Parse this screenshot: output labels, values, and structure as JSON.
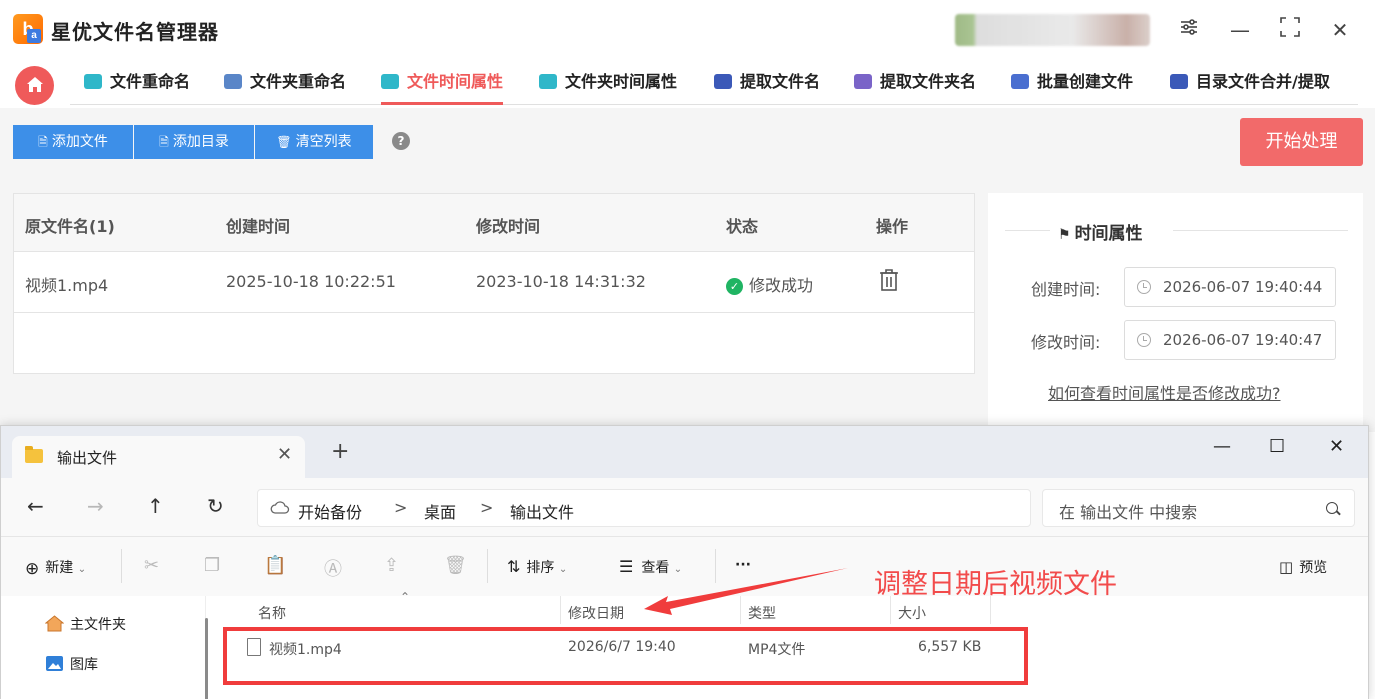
{
  "app": {
    "title": "星优文件名管理器",
    "logo_text": "b",
    "logo_sub": "a"
  },
  "window_controls": {
    "settings": "⚙",
    "minimize": "—",
    "maximize": "▢",
    "close": "✕"
  },
  "tabs": [
    {
      "label": "文件重命名",
      "color": "#2fb7c9"
    },
    {
      "label": "文件夹重命名",
      "color": "#5a86c8"
    },
    {
      "label": "文件时间属性",
      "color": "#2fb7c9",
      "active": true
    },
    {
      "label": "文件夹时间属性",
      "color": "#2fb7c9"
    },
    {
      "label": "提取文件名",
      "color": "#3b59b8"
    },
    {
      "label": "提取文件夹名",
      "color": "#7a64c8"
    },
    {
      "label": "批量创建文件",
      "color": "#4a6fd0"
    },
    {
      "label": "目录文件合并/提取",
      "color": "#3b59b8"
    }
  ],
  "toolbar": {
    "add_file": "添加文件",
    "add_dir": "添加目录",
    "clear": "清空列表",
    "help": "?",
    "start": "开始处理",
    "accent": "#3d8fe8",
    "start_color": "#f26a6a"
  },
  "table": {
    "headers": [
      "原文件名(1)",
      "创建时间",
      "修改时间",
      "状态",
      "操作"
    ],
    "rows": [
      {
        "name": "视频1.mp4",
        "created": "2025-10-18 10:22:51",
        "modified": "2023-10-18 14:31:32",
        "status": "修改成功"
      }
    ]
  },
  "side": {
    "title": "时间属性",
    "created_label": "创建时间:",
    "created_value": "2026-06-07 19:40:44",
    "modified_label": "修改时间:",
    "modified_value": "2026-06-07 19:40:47",
    "link": "如何查看时间属性是否修改成功?"
  },
  "explorer": {
    "tab_label": "输出文件",
    "new_tab": "+",
    "controls": {
      "minimize": "—",
      "maximize": "☐",
      "close": "✕"
    },
    "nav": {
      "back": "←",
      "forward": "→",
      "up": "↑",
      "refresh": "↻"
    },
    "breadcrumb": [
      "开始备份",
      "桌面",
      "输出文件"
    ],
    "crumb_sep": ">",
    "search_placeholder": "在 输出文件 中搜索",
    "commands": {
      "new": "新建",
      "sort": "排序",
      "view": "查看",
      "more": "···",
      "preview": "预览"
    },
    "sidebar": [
      "主文件夹",
      "图库"
    ],
    "columns": [
      "名称",
      "修改日期",
      "类型",
      "大小"
    ],
    "files": [
      {
        "name": "视频1.mp4",
        "date": "2026/6/7 19:40",
        "type": "MP4文件",
        "size": "6,557 KB"
      }
    ]
  },
  "annotation": {
    "text": "调整日期后视频文件",
    "color": "#f24b4b"
  }
}
